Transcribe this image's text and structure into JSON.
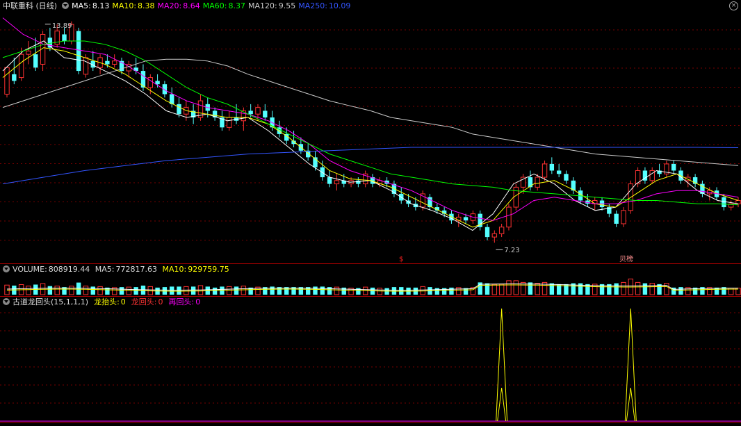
{
  "header": {
    "title": "中联重科 (日线)",
    "ma_items": [
      {
        "label": "MA5:",
        "value": "8.13",
        "color": "#ffffff"
      },
      {
        "label": "MA10:",
        "value": "8.38",
        "color": "#ffff00"
      },
      {
        "label": "MA20:",
        "value": "8.64",
        "color": "#ff00ff"
      },
      {
        "label": "MA60:",
        "value": "8.37",
        "color": "#00ff00"
      },
      {
        "label": "MA120:",
        "value": "9.55",
        "color": "#cccccc"
      },
      {
        "label": "MA250:",
        "value": "10.09",
        "color": "#3355ff"
      }
    ]
  },
  "volume_header": {
    "title": "VOLUME:",
    "value": "808919.44",
    "ma5_label": "MA5:",
    "ma5_value": "772817.63",
    "ma10_label": "MA10:",
    "ma10_value": "929759.75"
  },
  "indicator_header": {
    "title": "古道龙回头(15,1,1,1)",
    "items": [
      {
        "label": "龙抬头:",
        "value": "0",
        "color": "#ffff00"
      },
      {
        "label": "龙回头:",
        "value": "0",
        "color": "#ff3333"
      },
      {
        "label": "再回头:",
        "value": "0",
        "color": "#ff00ff"
      }
    ]
  },
  "annotations": {
    "high_label": "13.89",
    "low_label": "7.23",
    "marker_s": "$",
    "marker_bang": "贝榜"
  },
  "chart_data": {
    "type": "candlestick",
    "price_range": [
      6.9,
      14.2
    ],
    "high": 13.89,
    "low": 7.23,
    "candles": [
      [
        11.7,
        12.5,
        11.6,
        12.5
      ],
      [
        12.3,
        12.8,
        12.0,
        12.1
      ],
      [
        12.2,
        13.1,
        12.1,
        12.9
      ],
      [
        12.9,
        13.3,
        12.6,
        13.0
      ],
      [
        12.9,
        13.4,
        12.4,
        12.5
      ],
      [
        12.6,
        13.6,
        12.4,
        13.5
      ],
      [
        13.4,
        13.7,
        13.0,
        13.1
      ],
      [
        13.2,
        13.8,
        13.1,
        13.6
      ],
      [
        13.5,
        13.7,
        13.2,
        13.3
      ],
      [
        13.3,
        13.89,
        13.2,
        13.8
      ],
      [
        13.6,
        13.7,
        12.3,
        12.4
      ],
      [
        12.3,
        12.9,
        12.2,
        12.8
      ],
      [
        12.7,
        13.0,
        12.4,
        12.5
      ],
      [
        12.5,
        12.9,
        12.3,
        12.8
      ],
      [
        12.7,
        12.9,
        12.5,
        12.6
      ],
      [
        12.6,
        12.9,
        12.5,
        12.7
      ],
      [
        12.7,
        12.8,
        12.3,
        12.4
      ],
      [
        12.4,
        12.7,
        12.2,
        12.6
      ],
      [
        12.5,
        12.8,
        12.3,
        12.4
      ],
      [
        12.4,
        12.6,
        11.8,
        11.9
      ],
      [
        11.9,
        12.3,
        11.7,
        12.2
      ],
      [
        12.1,
        12.3,
        11.9,
        12.0
      ],
      [
        12.0,
        12.1,
        11.6,
        11.7
      ],
      [
        11.7,
        11.9,
        11.3,
        11.4
      ],
      [
        11.4,
        11.6,
        11.0,
        11.1
      ],
      [
        11.1,
        11.5,
        10.9,
        11.3
      ],
      [
        11.2,
        11.4,
        10.8,
        11.0
      ],
      [
        11.0,
        11.7,
        10.9,
        11.5
      ],
      [
        11.4,
        11.6,
        11.0,
        11.2
      ],
      [
        11.2,
        11.3,
        10.9,
        11.0
      ],
      [
        11.0,
        11.2,
        10.6,
        10.7
      ],
      [
        10.7,
        11.2,
        10.6,
        11.0
      ],
      [
        11.0,
        11.4,
        10.8,
        10.9
      ],
      [
        10.9,
        11.3,
        10.6,
        11.2
      ],
      [
        11.2,
        11.4,
        11.0,
        11.1
      ],
      [
        11.1,
        11.4,
        10.9,
        11.3
      ],
      [
        11.2,
        11.4,
        10.9,
        11.0
      ],
      [
        11.0,
        11.2,
        10.6,
        10.7
      ],
      [
        10.7,
        10.9,
        10.4,
        10.5
      ],
      [
        10.5,
        10.7,
        10.2,
        10.3
      ],
      [
        10.3,
        10.6,
        10.1,
        10.2
      ],
      [
        10.2,
        10.4,
        9.9,
        10.0
      ],
      [
        10.0,
        10.2,
        9.7,
        9.8
      ],
      [
        9.8,
        10.0,
        9.4,
        9.5
      ],
      [
        9.5,
        9.7,
        9.1,
        9.2
      ],
      [
        9.2,
        9.4,
        8.9,
        9.0
      ],
      [
        9.0,
        9.3,
        8.8,
        9.1
      ],
      [
        9.1,
        9.3,
        8.9,
        9.0
      ],
      [
        9.0,
        9.2,
        8.9,
        9.1
      ],
      [
        9.1,
        9.2,
        8.9,
        9.0
      ],
      [
        9.0,
        9.4,
        8.9,
        9.3
      ],
      [
        9.2,
        9.3,
        8.9,
        9.0
      ],
      [
        9.0,
        9.2,
        8.9,
        9.1
      ],
      [
        9.1,
        9.2,
        8.9,
        9.0
      ],
      [
        9.0,
        9.1,
        8.6,
        8.7
      ],
      [
        8.7,
        8.9,
        8.4,
        8.5
      ],
      [
        8.5,
        8.7,
        8.3,
        8.4
      ],
      [
        8.4,
        8.6,
        8.2,
        8.3
      ],
      [
        8.3,
        8.8,
        8.2,
        8.7
      ],
      [
        8.6,
        8.7,
        8.2,
        8.3
      ],
      [
        8.3,
        8.4,
        8.1,
        8.2
      ],
      [
        8.2,
        8.3,
        8.0,
        8.1
      ],
      [
        8.1,
        8.2,
        7.8,
        7.9
      ],
      [
        7.9,
        8.1,
        7.7,
        8.0
      ],
      [
        8.0,
        8.1,
        7.8,
        7.9
      ],
      [
        7.9,
        8.2,
        7.8,
        8.1
      ],
      [
        8.1,
        8.2,
        7.6,
        7.7
      ],
      [
        7.7,
        7.8,
        7.3,
        7.4
      ],
      [
        7.4,
        7.6,
        7.23,
        7.5
      ],
      [
        7.5,
        7.8,
        7.4,
        7.7
      ],
      [
        7.7,
        8.4,
        7.6,
        8.3
      ],
      [
        8.3,
        9.0,
        8.2,
        8.9
      ],
      [
        8.9,
        9.3,
        8.7,
        9.2
      ],
      [
        9.2,
        9.4,
        8.8,
        8.9
      ],
      [
        8.9,
        9.3,
        8.8,
        9.2
      ],
      [
        9.2,
        9.7,
        9.1,
        9.6
      ],
      [
        9.6,
        9.8,
        9.3,
        9.4
      ],
      [
        9.4,
        9.6,
        9.2,
        9.3
      ],
      [
        9.3,
        9.4,
        9.0,
        9.1
      ],
      [
        9.1,
        9.2,
        8.7,
        8.8
      ],
      [
        8.8,
        8.9,
        8.4,
        8.5
      ],
      [
        8.5,
        8.7,
        8.3,
        8.4
      ],
      [
        8.4,
        8.6,
        8.2,
        8.5
      ],
      [
        8.5,
        8.6,
        8.2,
        8.3
      ],
      [
        8.3,
        8.4,
        8.0,
        8.1
      ],
      [
        8.1,
        8.2,
        7.7,
        7.8
      ],
      [
        7.8,
        8.3,
        7.7,
        8.2
      ],
      [
        8.2,
        9.1,
        8.1,
        9.0
      ],
      [
        9.0,
        9.5,
        8.9,
        9.4
      ],
      [
        9.4,
        9.5,
        9.0,
        9.1
      ],
      [
        9.1,
        9.5,
        9.0,
        9.4
      ],
      [
        9.4,
        9.6,
        9.2,
        9.3
      ],
      [
        9.3,
        9.7,
        9.2,
        9.6
      ],
      [
        9.6,
        9.7,
        9.3,
        9.4
      ],
      [
        9.4,
        9.5,
        9.0,
        9.1
      ],
      [
        9.1,
        9.3,
        8.9,
        9.2
      ],
      [
        9.2,
        9.3,
        8.9,
        9.0
      ],
      [
        9.0,
        9.1,
        8.6,
        8.7
      ],
      [
        8.7,
        8.9,
        8.5,
        8.8
      ],
      [
        8.8,
        8.9,
        8.5,
        8.6
      ],
      [
        8.6,
        8.7,
        8.2,
        8.3
      ],
      [
        8.3,
        8.5,
        8.2,
        8.4
      ],
      [
        8.4,
        8.6,
        8.3,
        8.5
      ]
    ],
    "ma_lines": [
      {
        "name": "MA5",
        "color": "#ffffff",
        "values": [
          12.4,
          13.0,
          13.3,
          12.8,
          12.7,
          12.4,
          12.1,
          11.7,
          11.2,
          11.0,
          11.1,
          10.9,
          11.0,
          10.6,
          10.1,
          9.6,
          9.2,
          9.05,
          9.1,
          8.8,
          8.4,
          8.2,
          7.95,
          7.6,
          8.1,
          9.0,
          9.3,
          9.0,
          8.5,
          8.2,
          8.3,
          9.0,
          9.4,
          9.3,
          8.8,
          8.5,
          8.4
        ]
      },
      {
        "name": "MA10",
        "color": "#ffff00",
        "values": [
          12.2,
          12.7,
          13.1,
          13.0,
          12.8,
          12.6,
          12.3,
          11.9,
          11.5,
          11.2,
          11.1,
          11.0,
          11.0,
          10.8,
          10.4,
          9.9,
          9.4,
          9.15,
          9.1,
          8.9,
          8.6,
          8.3,
          8.0,
          7.7,
          7.9,
          8.6,
          9.0,
          9.1,
          8.8,
          8.4,
          8.3,
          8.7,
          9.1,
          9.3,
          9.0,
          8.7,
          8.5
        ]
      },
      {
        "name": "MA20",
        "color": "#ff00ff",
        "values": [
          14.0,
          13.5,
          13.2,
          13.1,
          13.0,
          12.9,
          12.6,
          12.2,
          11.8,
          11.5,
          11.3,
          11.2,
          11.1,
          10.9,
          10.6,
          10.2,
          9.7,
          9.4,
          9.2,
          9.0,
          8.8,
          8.5,
          8.2,
          8.0,
          7.9,
          8.1,
          8.5,
          8.6,
          8.5,
          8.4,
          8.4,
          8.5,
          8.7,
          8.8,
          8.8,
          8.7,
          8.6
        ]
      },
      {
        "name": "MA60",
        "color": "#00ff00",
        "values": [
          12.8,
          13.0,
          13.2,
          13.3,
          13.3,
          13.2,
          13.0,
          12.7,
          12.3,
          11.9,
          11.6,
          11.4,
          11.1,
          10.8,
          10.5,
          10.2,
          9.9,
          9.7,
          9.5,
          9.3,
          9.2,
          9.1,
          9.0,
          8.95,
          8.9,
          8.8,
          8.75,
          8.7,
          8.65,
          8.6,
          8.55,
          8.5,
          8.5,
          8.45,
          8.4,
          8.4,
          8.37
        ]
      },
      {
        "name": "MA120",
        "color": "#cccccc",
        "values": [
          11.3,
          11.5,
          11.7,
          11.9,
          12.1,
          12.3,
          12.5,
          12.7,
          12.75,
          12.75,
          12.7,
          12.55,
          12.3,
          12.1,
          11.9,
          11.7,
          11.5,
          11.35,
          11.2,
          11.0,
          10.9,
          10.8,
          10.7,
          10.5,
          10.4,
          10.3,
          10.2,
          10.1,
          10.0,
          9.9,
          9.85,
          9.8,
          9.75,
          9.7,
          9.65,
          9.6,
          9.55
        ]
      },
      {
        "name": "MA250",
        "color": "#3355ff",
        "values": [
          null,
          null,
          null,
          null,
          null,
          null,
          null,
          null,
          null,
          null,
          null,
          null,
          null,
          null,
          null,
          null,
          null,
          null,
          null,
          null,
          null,
          null,
          null,
          null,
          null,
          null,
          null,
          null,
          null,
          null,
          null,
          null,
          null,
          null,
          null,
          null,
          null
        ]
      },
      {
        "name": "MA250",
        "color": "#3355ff",
        "values": [
          9.0,
          9.2,
          9.4,
          9.55,
          9.7,
          9.8,
          9.9,
          9.95,
          10.0,
          10.05,
          10.1,
          10.1,
          10.1,
          10.1,
          10.1,
          10.1,
          10.1,
          10.1,
          10.09
        ]
      }
    ],
    "signal_peaks": [
      {
        "name": "龙抬头",
        "color": "#ffff00",
        "candle_index": 69
      },
      {
        "name": "龙抬头",
        "color": "#ffff00",
        "candle_index": 87
      }
    ]
  }
}
